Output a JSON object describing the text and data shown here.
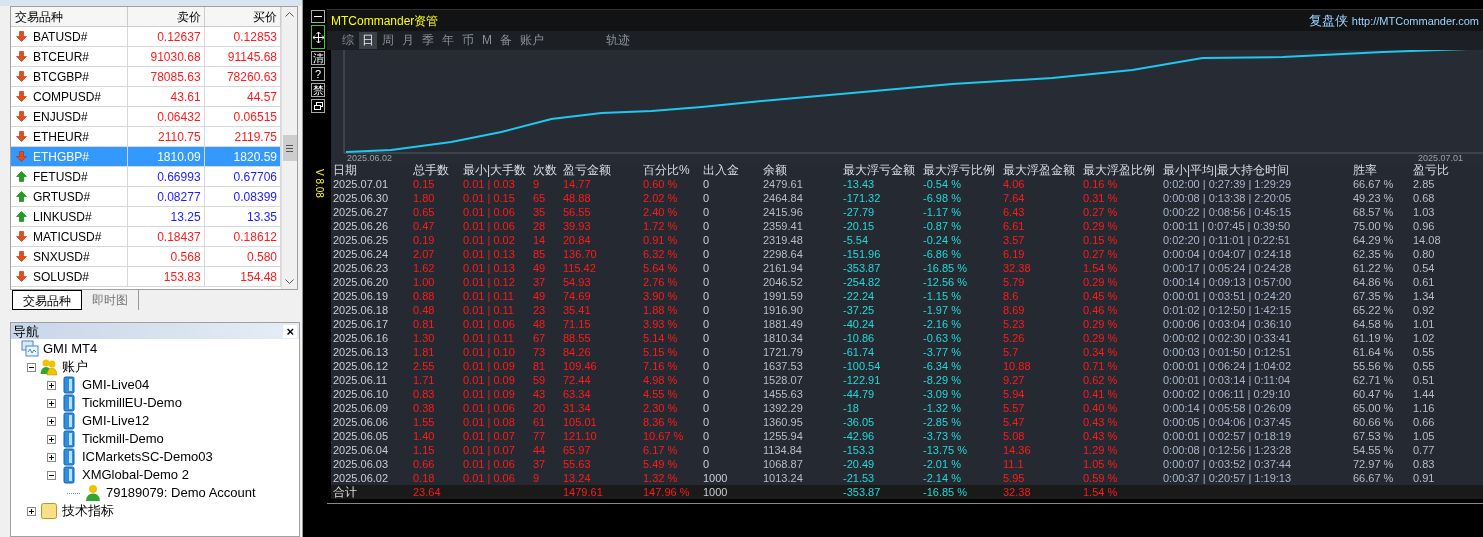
{
  "market_watch": {
    "columns": [
      "交易品种",
      "卖价",
      "买价"
    ],
    "rows": [
      {
        "symbol": "BATUSD#",
        "bid": "0.12637",
        "ask": "0.12853",
        "kind": "down",
        "selected": false
      },
      {
        "symbol": "BTCEUR#",
        "bid": "91030.68",
        "ask": "91145.68",
        "kind": "down",
        "selected": false
      },
      {
        "symbol": "BTCGBP#",
        "bid": "78085.63",
        "ask": "78260.63",
        "kind": "down",
        "selected": false
      },
      {
        "symbol": "COMPUSD#",
        "bid": "43.61",
        "ask": "44.57",
        "kind": "down",
        "selected": false
      },
      {
        "symbol": "ENJUSD#",
        "bid": "0.06432",
        "ask": "0.06515",
        "kind": "down",
        "selected": false
      },
      {
        "symbol": "ETHEUR#",
        "bid": "2110.75",
        "ask": "2119.75",
        "kind": "down",
        "selected": false
      },
      {
        "symbol": "ETHGBP#",
        "bid": "1810.09",
        "ask": "1820.59",
        "kind": "down",
        "selected": true
      },
      {
        "symbol": "FETUSD#",
        "bid": "0.66993",
        "ask": "0.67706",
        "kind": "up",
        "selected": false
      },
      {
        "symbol": "GRTUSD#",
        "bid": "0.08277",
        "ask": "0.08399",
        "kind": "up",
        "selected": false
      },
      {
        "symbol": "LINKUSD#",
        "bid": "13.25",
        "ask": "13.35",
        "kind": "up",
        "selected": false
      },
      {
        "symbol": "MATICUSD#",
        "bid": "0.18437",
        "ask": "0.18612",
        "kind": "down",
        "selected": false
      },
      {
        "symbol": "SNXUSD#",
        "bid": "0.568",
        "ask": "0.580",
        "kind": "down",
        "selected": false
      },
      {
        "symbol": "SOLUSD#",
        "bid": "153.83",
        "ask": "154.48",
        "kind": "down",
        "selected": false
      }
    ]
  },
  "tabs": [
    {
      "label": "交易品种",
      "selected": true
    },
    {
      "label": "即时图",
      "selected": false
    }
  ],
  "navigator": {
    "title": "导航",
    "close": "×",
    "tree": [
      {
        "label": "GMI MT4",
        "kind": "terminal",
        "children": [
          {
            "label": "账户",
            "kind": "accounts",
            "expanded": true,
            "children": [
              {
                "label": "GMI-Live04",
                "kind": "server",
                "expanded": false
              },
              {
                "label": "TickmillEU-Demo",
                "kind": "server",
                "expanded": false
              },
              {
                "label": "GMI-Live12",
                "kind": "server",
                "expanded": false
              },
              {
                "label": "Tickmill-Demo",
                "kind": "server",
                "expanded": false
              },
              {
                "label": "ICMarketsSC-Demo03",
                "kind": "server",
                "expanded": false
              },
              {
                "label": "XMGlobal-Demo 2",
                "kind": "server",
                "expanded": true,
                "children": [
                  {
                    "label": "79189079: Demo Account",
                    "kind": "account"
                  }
                ]
              }
            ]
          },
          {
            "label": "技术指标",
            "kind": "indicators",
            "expanded": false
          }
        ]
      }
    ]
  },
  "commander": {
    "title": "MTCommander资管",
    "brand": "复盘侠",
    "url": "http://MTCommander.com",
    "version": "V 8.08",
    "toolbar": [
      {
        "kind": "minimize"
      },
      {
        "kind": "move"
      },
      {
        "kind": "text",
        "label": "清"
      },
      {
        "kind": "text",
        "label": "?"
      },
      {
        "kind": "text",
        "label": "禁"
      },
      {
        "kind": "window"
      }
    ],
    "period_tabs": [
      {
        "label": "综",
        "selected": false
      },
      {
        "label": "日",
        "selected": true
      },
      {
        "label": "周",
        "selected": false
      },
      {
        "label": "月",
        "selected": false
      },
      {
        "label": "季",
        "selected": false
      },
      {
        "label": "年",
        "selected": false
      },
      {
        "label": "币",
        "selected": false
      },
      {
        "label": "M",
        "selected": false
      },
      {
        "label": "备",
        "selected": false
      },
      {
        "label": "账户",
        "selected": false
      }
    ],
    "view_tabs": [
      {
        "label": "轨迹",
        "selected": false
      }
    ],
    "chart": {
      "start_label": "2025.06.02",
      "end_label": "2025.07.01"
    },
    "table": {
      "columns": [
        "日期",
        "总手数",
        "最小|大手数",
        "次数",
        "盈亏金额",
        "百分比%",
        "出入金",
        "余额",
        "最大浮亏金额",
        "最大浮亏比例",
        "最大浮盈金额",
        "最大浮盈比例",
        "最小|平均|最大持仓时间",
        "胜率",
        "盈亏比"
      ],
      "rows": [
        [
          "2025.07.01",
          "0.15",
          "0.01 | 0.03",
          "9",
          "14.77",
          "0.60 %",
          "0",
          "2479.61",
          "-13.43",
          "-0.54 %",
          "4.06",
          "0.16 %",
          "0:02:00 | 0:27:39 | 1:29:29",
          "66.67 %",
          "2.85"
        ],
        [
          "2025.06.30",
          "1.80",
          "0.01 | 0.15",
          "65",
          "48.88",
          "2.02 %",
          "0",
          "2464.84",
          "-171.32",
          "-6.98 %",
          "7.64",
          "0.31 %",
          "0:00:08 | 0:13:38 | 2:20:05",
          "49.23 %",
          "0.68"
        ],
        [
          "2025.06.27",
          "0.65",
          "0.01 | 0.06",
          "35",
          "56.55",
          "2.40 %",
          "0",
          "2415.96",
          "-27.79",
          "-1.17 %",
          "6.43",
          "0.27 %",
          "0:00:22 | 0:08:56 | 0:45:15",
          "68.57 %",
          "1.03"
        ],
        [
          "2025.06.26",
          "0.47",
          "0.01 | 0.06",
          "28",
          "39.93",
          "1.72 %",
          "0",
          "2359.41",
          "-20.15",
          "-0.87 %",
          "6.61",
          "0.29 %",
          "0:00:11 | 0:07:45 | 0:39:50",
          "75.00 %",
          "0.96"
        ],
        [
          "2025.06.25",
          "0.19",
          "0.01 | 0.02",
          "14",
          "20.84",
          "0.91 %",
          "0",
          "2319.48",
          "-5.54",
          "-0.24 %",
          "3.57",
          "0.15 %",
          "0:02:20 | 0:11:01 | 0:22:51",
          "64.29 %",
          "14.08"
        ],
        [
          "2025.06.24",
          "2.07",
          "0.01 | 0.13",
          "85",
          "136.70",
          "6.32 %",
          "0",
          "2298.64",
          "-151.96",
          "-6.86 %",
          "6.19",
          "0.27 %",
          "0:00:04 | 0:04:07 | 0:24:18",
          "62.35 %",
          "0.80"
        ],
        [
          "2025.06.23",
          "1.62",
          "0.01 | 0.13",
          "49",
          "115.42",
          "5.64 %",
          "0",
          "2161.94",
          "-353.87",
          "-16.85 %",
          "32.38",
          "1.54 %",
          "0:00:17 | 0:05:24 | 0:24:28",
          "61.22 %",
          "0.54"
        ],
        [
          "2025.06.20",
          "1.00",
          "0.01 | 0.12",
          "37",
          "54.93",
          "2.76 %",
          "0",
          "2046.52",
          "-254.82",
          "-12.56 %",
          "5.79",
          "0.29 %",
          "0:00:14 | 0:09:13 | 0:57:00",
          "64.86 %",
          "0.61"
        ],
        [
          "2025.06.19",
          "0.88",
          "0.01 | 0.11",
          "49",
          "74.69",
          "3.90 %",
          "0",
          "1991.59",
          "-22.24",
          "-1.15 %",
          "8.6",
          "0.45 %",
          "0:00:01 | 0:03:51 | 0:24:20",
          "67.35 %",
          "1.34"
        ],
        [
          "2025.06.18",
          "0.48",
          "0.01 | 0.11",
          "23",
          "35.41",
          "1.88 %",
          "0",
          "1916.90",
          "-37.25",
          "-1.97 %",
          "8.69",
          "0.46 %",
          "0:01:02 | 0:12:50 | 1:42:15",
          "65.22 %",
          "0.92"
        ],
        [
          "2025.06.17",
          "0.81",
          "0.01 | 0.06",
          "48",
          "71.15",
          "3.93 %",
          "0",
          "1881.49",
          "-40.24",
          "-2.16 %",
          "5.23",
          "0.29 %",
          "0:00:06 | 0:03:04 | 0:36:10",
          "64.58 %",
          "1.01"
        ],
        [
          "2025.06.16",
          "1.30",
          "0.01 | 0.11",
          "67",
          "88.55",
          "5.14 %",
          "0",
          "1810.34",
          "-10.86",
          "-0.63 %",
          "5.26",
          "0.29 %",
          "0:00:02 | 0:02:30 | 0:33:41",
          "61.19 %",
          "1.02"
        ],
        [
          "2025.06.13",
          "1.81",
          "0.01 | 0.10",
          "73",
          "84.26",
          "5.15 %",
          "0",
          "1721.79",
          "-61.74",
          "-3.77 %",
          "5.7",
          "0.34 %",
          "0:00:03 | 0:01:50 | 0:12:51",
          "61.64 %",
          "0.55"
        ],
        [
          "2025.06.12",
          "2.55",
          "0.01 | 0.09",
          "81",
          "109.46",
          "7.16 %",
          "0",
          "1637.53",
          "-100.54",
          "-6.34 %",
          "10.88",
          "0.71 %",
          "0:00:01 | 0:06:24 | 1:04:02",
          "55.56 %",
          "0.55"
        ],
        [
          "2025.06.11",
          "1.71",
          "0.01 | 0.09",
          "59",
          "72.44",
          "4.98 %",
          "0",
          "1528.07",
          "-122.91",
          "-8.29 %",
          "9.27",
          "0.62 %",
          "0:00:01 | 0:03:14 | 0:11:04",
          "62.71 %",
          "0.51"
        ],
        [
          "2025.06.10",
          "0.83",
          "0.01 | 0.09",
          "43",
          "63.34",
          "4.55 %",
          "0",
          "1455.63",
          "-44.79",
          "-3.09 %",
          "5.94",
          "0.41 %",
          "0:00:02 | 0:06:11 | 0:29:10",
          "60.47 %",
          "1.44"
        ],
        [
          "2025.06.09",
          "0.38",
          "0.01 | 0.06",
          "20",
          "31.34",
          "2.30 %",
          "0",
          "1392.29",
          "-18",
          "-1.32 %",
          "5.57",
          "0.40 %",
          "0:00:14 | 0:05:58 | 0:26:09",
          "65.00 %",
          "1.16"
        ],
        [
          "2025.06.06",
          "1.55",
          "0.01 | 0.08",
          "61",
          "105.01",
          "8.36 %",
          "0",
          "1360.95",
          "-36.05",
          "-2.85 %",
          "5.47",
          "0.43 %",
          "0:00:05 | 0:04:06 | 0:37:45",
          "60.66 %",
          "0.66"
        ],
        [
          "2025.06.05",
          "1.40",
          "0.01 | 0.07",
          "77",
          "121.10",
          "10.67 %",
          "0",
          "1255.94",
          "-42.96",
          "-3.73 %",
          "5.08",
          "0.43 %",
          "0:00:01 | 0:02:57 | 0:18:19",
          "67.53 %",
          "1.05"
        ],
        [
          "2025.06.04",
          "1.15",
          "0.01 | 0.07",
          "44",
          "65.97",
          "6.17 %",
          "0",
          "1134.84",
          "-153.3",
          "-13.75 %",
          "14.36",
          "1.29 %",
          "0:00:08 | 0:12:56 | 1:23:28",
          "54.55 %",
          "0.77"
        ],
        [
          "2025.06.03",
          "0.66",
          "0.01 | 0.06",
          "37",
          "55.63",
          "5.49 %",
          "0",
          "1068.87",
          "-20.49",
          "-2.01 %",
          "11.1",
          "1.05 %",
          "0:00:07 | 0:03:52 | 0:37:44",
          "72.97 %",
          "0.83"
        ],
        [
          "2025.06.02",
          "0.18",
          "0.01 | 0.06",
          "9",
          "13.24",
          "1.32 %",
          "1000",
          "1013.24",
          "-21.53",
          "-2.14 %",
          "5.95",
          "0.59 %",
          "0:00:37 | 0:20:57 | 1:19:13",
          "66.67 %",
          "0.91"
        ]
      ],
      "total": {
        "label": "合计",
        "total_lots": "23.64",
        "profit": "1479.61",
        "percent": "147.96 %",
        "deposit": "1000",
        "max_float_loss": "-353.87",
        "max_float_loss_pct": "-16.85 %",
        "max_float_profit": "32.38",
        "max_float_profit_pct": "1.54 %"
      }
    }
  }
}
